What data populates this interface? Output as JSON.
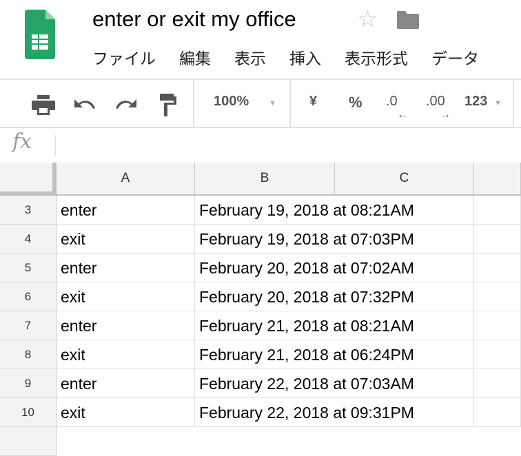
{
  "header": {
    "title": "enter or exit my office",
    "menu": [
      "ファイル",
      "編集",
      "表示",
      "挿入",
      "表示形式",
      "データ"
    ]
  },
  "toolbar": {
    "zoom": "100%",
    "currency": "¥",
    "percent": "%",
    "decrease_decimal": ".0",
    "increase_decimal": ".00",
    "more_formats": "123"
  },
  "formula_bar": {
    "fx": "fx",
    "value": ""
  },
  "columns": [
    "A",
    "B",
    "C"
  ],
  "rows": [
    {
      "num": "3",
      "a": "enter",
      "b": "February 19, 2018 at 08:21AM"
    },
    {
      "num": "4",
      "a": "exit",
      "b": "February 19, 2018 at 07:03PM"
    },
    {
      "num": "5",
      "a": "enter",
      "b": "February 20, 2018 at 07:02AM"
    },
    {
      "num": "6",
      "a": "exit",
      "b": "February 20, 2018 at 07:32PM"
    },
    {
      "num": "7",
      "a": "enter",
      "b": "February 21, 2018 at 08:21AM"
    },
    {
      "num": "8",
      "a": "exit",
      "b": "February 21, 2018 at 06:24PM"
    },
    {
      "num": "9",
      "a": "enter",
      "b": "February 22, 2018 at 07:03AM"
    },
    {
      "num": "10",
      "a": "exit",
      "b": "February 22, 2018 at 09:31PM"
    }
  ]
}
